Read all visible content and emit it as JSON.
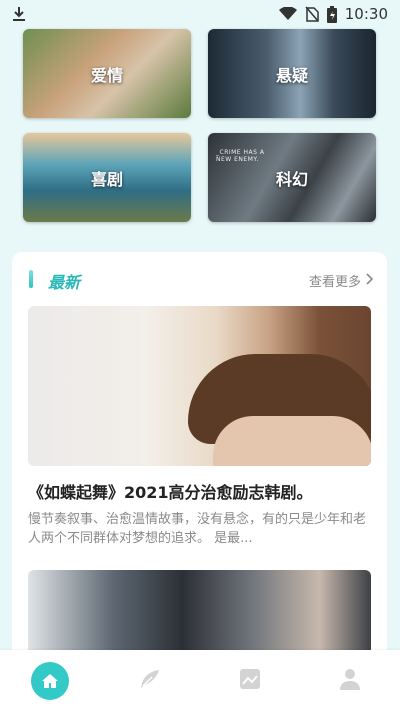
{
  "status_bar": {
    "time": "10:30",
    "icons": [
      "download-icon",
      "wifi-icon",
      "no-sim-icon",
      "battery-icon"
    ]
  },
  "categories": [
    {
      "label": "爱情",
      "icon": "romance-image"
    },
    {
      "label": "悬疑",
      "icon": "suspense-image"
    },
    {
      "label": "喜剧",
      "icon": "comedy-image"
    },
    {
      "label": "科幻",
      "icon": "scifi-image",
      "poster_text": "_CRIME HAS A NEW ENEMY."
    }
  ],
  "latest": {
    "title": "最新",
    "more_label": "查看更多",
    "articles": [
      {
        "title": "《如蝶起舞》2021高分治愈励志韩剧。",
        "description": "慢节奏叙事、治愈温情故事，没有悬念，有的只是少年和老人两个不同群体对梦想的追求。 是最..."
      }
    ]
  },
  "tab_bar": {
    "items": [
      "home-icon",
      "discover-icon",
      "image-icon",
      "profile-icon"
    ],
    "active": "home-icon"
  },
  "colors": {
    "accent": "#33c9c6",
    "background": "#e8f8f8",
    "muted_text": "#8a8a8a"
  }
}
